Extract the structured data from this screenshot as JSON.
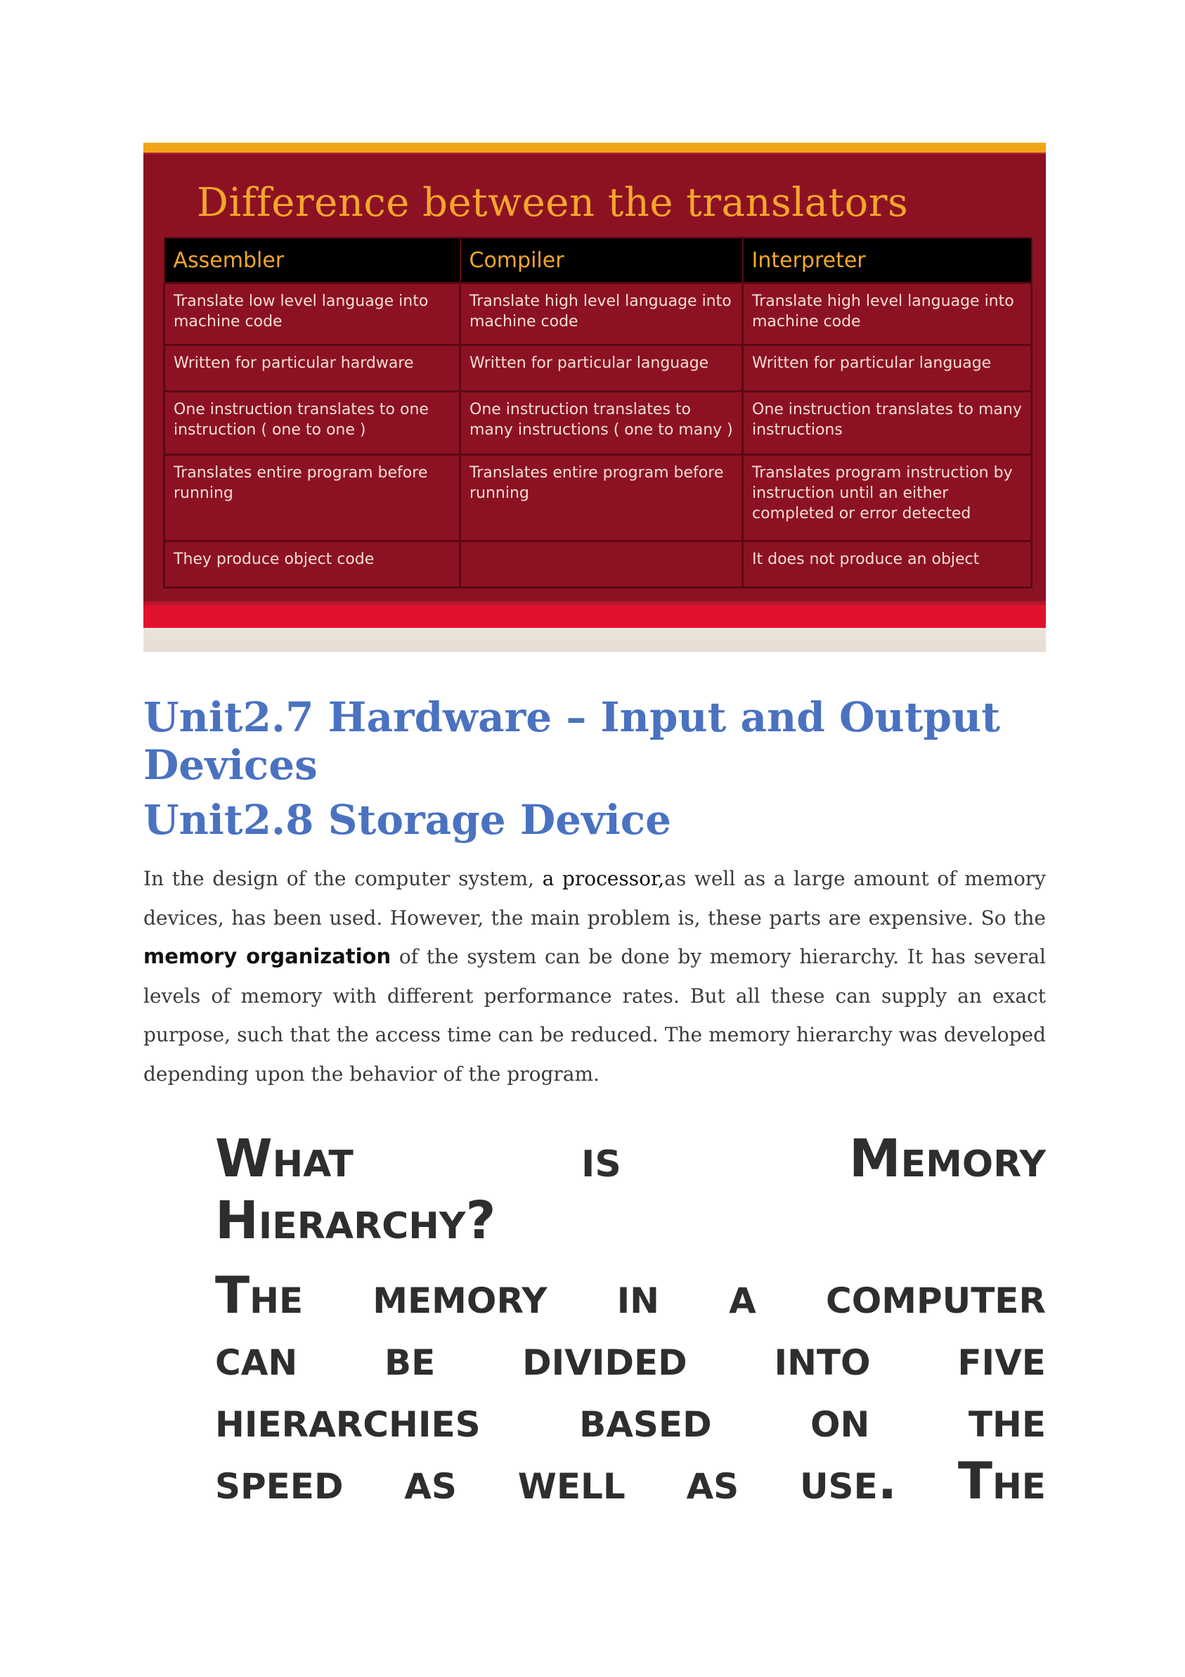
{
  "slide": {
    "title": "Difference between the translators",
    "headers": [
      "Assembler",
      "Compiler",
      "Interpreter"
    ],
    "rows": [
      [
        "Translate low level language into machine code",
        "Translate high level language into machine code",
        "Translate high level language into machine code"
      ],
      [
        "Written for particular hardware",
        "Written for particular language",
        "Written for particular language"
      ],
      [
        "One instruction translates to one instruction ( one to one )",
        "One instruction translates to many instructions ( one to many )",
        "One instruction translates to many instructions"
      ],
      [
        "Translates entire program before running",
        "Translates entire program before running",
        "Translates program instruction by instruction until an either completed or error detected"
      ],
      [
        "They produce object code",
        "",
        "It does not produce an object"
      ]
    ],
    "colors": {
      "background": "#8c1223",
      "title": "#f4a62b",
      "header_bg": "#000000"
    }
  },
  "headings": {
    "unit_2_7": "Unit2.7 Hardware – Input and Output Devices",
    "unit_2_8": "Unit2.8 Storage Device",
    "color": "#4a72c0"
  },
  "paragraph": {
    "part1": "In the design of the computer system, ",
    "processor": "a processor,",
    "part2": "as well as a large amount of memory devices, has been used. However, the main problem is, these parts are expensive. So the ",
    "memory_org": "memory organization",
    "part3": " of the system can be done by memory hierarchy. It has several levels of memory with different performance rates. But all these can supply an exact purpose, such that the access time can be reduced. The memory hierarchy was developed depending upon the behavior of the program."
  },
  "question": {
    "words_line1": [
      "What",
      "is",
      "Memory"
    ],
    "line2": "Hierarchy?"
  },
  "big_body": {
    "lines": [
      [
        "The",
        "memory",
        "in",
        "a",
        "computer"
      ],
      [
        "can",
        "be",
        "divided",
        "into",
        "five"
      ],
      [
        "hierarchies",
        "based",
        "on",
        "the"
      ],
      [
        "speed",
        "as",
        "well",
        "as",
        "use.",
        "The"
      ]
    ]
  }
}
